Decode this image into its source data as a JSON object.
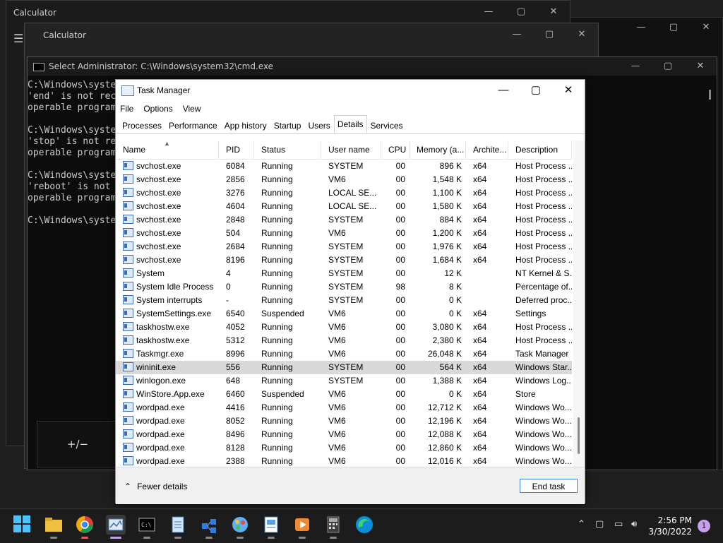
{
  "background_windows": {
    "calculator1_title": "Calculator",
    "calculator2_title": "Calculator",
    "calc_button_label": "+/−"
  },
  "cmd": {
    "title": "Select Administrator: C:\\Windows\\system32\\cmd.exe",
    "lines": [
      "C:\\Windows\\syste",
      "'end' is not rec",
      "operable program",
      "",
      "C:\\Windows\\syste",
      "'stop' is not re",
      "operable program",
      "",
      "C:\\Windows\\syste",
      "'reboot' is not",
      "operable program",
      "",
      "C:\\Windows\\syste"
    ]
  },
  "taskmanager": {
    "title": "Task Manager",
    "menu": [
      "File",
      "Options",
      "View"
    ],
    "tabs": [
      "Processes",
      "Performance",
      "App history",
      "Startup",
      "Users",
      "Details",
      "Services"
    ],
    "active_tab": "Details",
    "columns": [
      "Name",
      "PID",
      "Status",
      "User name",
      "CPU",
      "Memory (a...",
      "Archite...",
      "Description"
    ],
    "rows": [
      [
        "svchost.exe",
        "6084",
        "Running",
        "SYSTEM",
        "00",
        "896 K",
        "x64",
        "Host Process ..."
      ],
      [
        "svchost.exe",
        "2856",
        "Running",
        "VM6",
        "00",
        "1,548 K",
        "x64",
        "Host Process ..."
      ],
      [
        "svchost.exe",
        "3276",
        "Running",
        "LOCAL SE...",
        "00",
        "1,100 K",
        "x64",
        "Host Process ..."
      ],
      [
        "svchost.exe",
        "4604",
        "Running",
        "LOCAL SE...",
        "00",
        "1,580 K",
        "x64",
        "Host Process ..."
      ],
      [
        "svchost.exe",
        "2848",
        "Running",
        "SYSTEM",
        "00",
        "884 K",
        "x64",
        "Host Process ..."
      ],
      [
        "svchost.exe",
        "504",
        "Running",
        "VM6",
        "00",
        "1,200 K",
        "x64",
        "Host Process ..."
      ],
      [
        "svchost.exe",
        "2684",
        "Running",
        "SYSTEM",
        "00",
        "1,976 K",
        "x64",
        "Host Process ..."
      ],
      [
        "svchost.exe",
        "8196",
        "Running",
        "SYSTEM",
        "00",
        "1,684 K",
        "x64",
        "Host Process ..."
      ],
      [
        "System",
        "4",
        "Running",
        "SYSTEM",
        "00",
        "12 K",
        "",
        "NT Kernel & S..."
      ],
      [
        "System Idle Process",
        "0",
        "Running",
        "SYSTEM",
        "98",
        "8 K",
        "",
        "Percentage of..."
      ],
      [
        "System interrupts",
        "-",
        "Running",
        "SYSTEM",
        "00",
        "0 K",
        "",
        "Deferred proc..."
      ],
      [
        "SystemSettings.exe",
        "6540",
        "Suspended",
        "VM6",
        "00",
        "0 K",
        "x64",
        "Settings"
      ],
      [
        "taskhostw.exe",
        "4052",
        "Running",
        "VM6",
        "00",
        "3,080 K",
        "x64",
        "Host Process ..."
      ],
      [
        "taskhostw.exe",
        "5312",
        "Running",
        "VM6",
        "00",
        "2,380 K",
        "x64",
        "Host Process ..."
      ],
      [
        "Taskmgr.exe",
        "8996",
        "Running",
        "VM6",
        "00",
        "26,048 K",
        "x64",
        "Task Manager"
      ],
      [
        "wininit.exe",
        "556",
        "Running",
        "SYSTEM",
        "00",
        "564 K",
        "x64",
        "Windows Star..."
      ],
      [
        "winlogon.exe",
        "648",
        "Running",
        "SYSTEM",
        "00",
        "1,388 K",
        "x64",
        "Windows Log..."
      ],
      [
        "WinStore.App.exe",
        "6460",
        "Suspended",
        "VM6",
        "00",
        "0 K",
        "x64",
        "Store"
      ],
      [
        "wordpad.exe",
        "4416",
        "Running",
        "VM6",
        "00",
        "12,712 K",
        "x64",
        "Windows Wo..."
      ],
      [
        "wordpad.exe",
        "8052",
        "Running",
        "VM6",
        "00",
        "12,196 K",
        "x64",
        "Windows Wo..."
      ],
      [
        "wordpad.exe",
        "8496",
        "Running",
        "VM6",
        "00",
        "12,088 K",
        "x64",
        "Windows Wo..."
      ],
      [
        "wordpad.exe",
        "8128",
        "Running",
        "VM6",
        "00",
        "12,860 K",
        "x64",
        "Windows Wo..."
      ],
      [
        "wordpad.exe",
        "2388",
        "Running",
        "VM6",
        "00",
        "12,016 K",
        "x64",
        "Windows Wo..."
      ]
    ],
    "selected_row": 15,
    "fewer_details_label": "Fewer details",
    "end_task_label": "End task"
  },
  "taskbar": {
    "time": "2:56 PM",
    "date": "3/30/2022",
    "notification_count": "1"
  },
  "colors": {
    "accent": "#3b82d8",
    "selected_row": "#d9d9d9"
  }
}
